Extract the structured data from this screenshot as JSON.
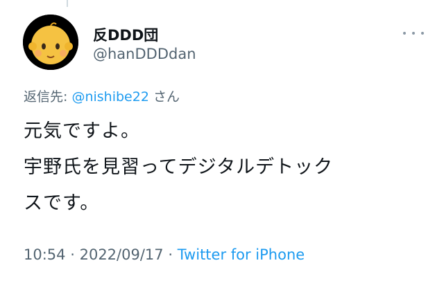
{
  "author": {
    "display_name": "反DDD団",
    "handle": "@hanDDDdan",
    "avatar_icon": "baby-emoji-icon"
  },
  "more_icon": "more-dots-icon",
  "reply": {
    "prefix": "返信先:",
    "mention": "@nishibe22",
    "suffix": "さん"
  },
  "body": {
    "lines": [
      "元気ですよ。",
      "宇野氏を見習ってデジタルデトック",
      "スです。"
    ]
  },
  "meta": {
    "time": "10:54",
    "separator1": "·",
    "date": "2022/09/17",
    "separator2": "·",
    "source": "Twitter for iPhone"
  },
  "colors": {
    "link": "#1d9bf0",
    "secondary_text": "#536471",
    "primary_text": "#0f1419"
  }
}
